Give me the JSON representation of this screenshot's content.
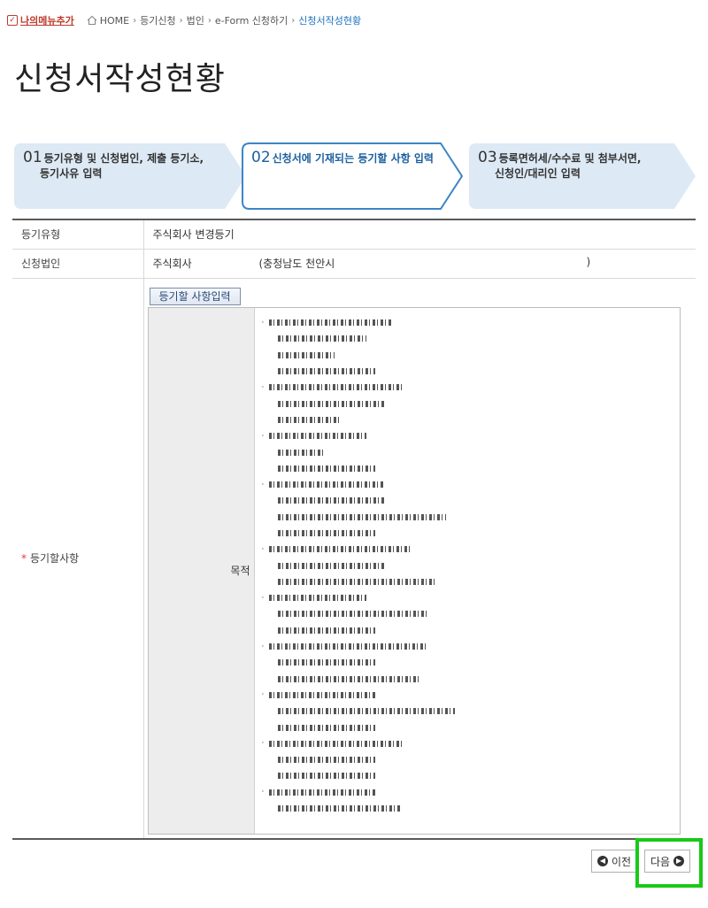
{
  "header": {
    "my_menu_label": "나의메뉴추가",
    "breadcrumb": [
      "HOME",
      "등기신청",
      "법인",
      "e-Form 신청하기",
      "신청서작성현황"
    ]
  },
  "page_title": "신청서작성현황",
  "steps": [
    {
      "num": "01",
      "line1": "등기유형 및 신청법인, 제출 등기소,",
      "line2": "등기사유 입력",
      "active": false
    },
    {
      "num": "02",
      "line1": "신청서에 기재되는 등기할 사항 입력",
      "line2": "",
      "active": true
    },
    {
      "num": "03",
      "line1": "등록면허세/수수료 및 첨부서면,",
      "line2": "신청인/대리인 입력",
      "active": false
    }
  ],
  "form": {
    "type_label": "등기유형",
    "type_value": "주식회사 변경등기",
    "corp_label": "신청법인",
    "corp_kind": "주식회사",
    "corp_location": "(충청남도 천안시",
    "corp_close": ")",
    "items_label": "등기할사항",
    "required_mark": "*",
    "input_button_label": "등기할 사항입력",
    "purpose_label": "목적",
    "purpose_line_count": 31
  },
  "nav": {
    "prev_label": "이전",
    "next_label": "다음"
  },
  "colors": {
    "accent": "#1a5f9e",
    "highlight": "#19c919",
    "required": "#e53935",
    "step_bg": "#dde9f4"
  }
}
